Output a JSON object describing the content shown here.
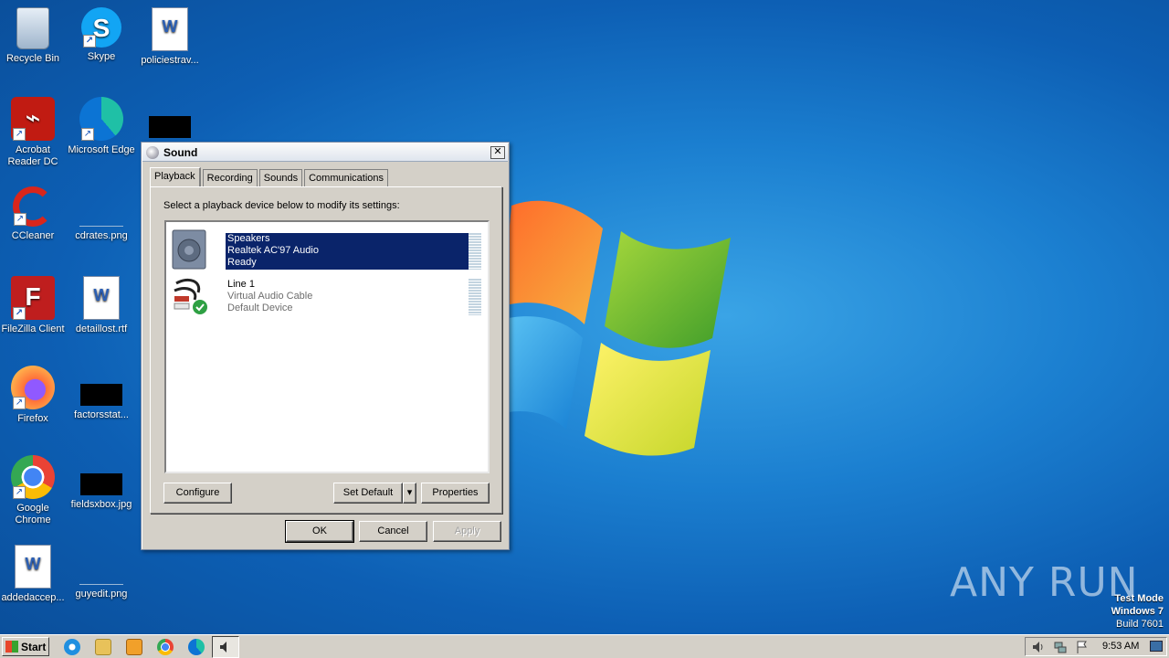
{
  "desktop": {
    "icons": [
      {
        "label": "Recycle Bin"
      },
      {
        "label": "Skype"
      },
      {
        "label": "policiestrav..."
      },
      {
        "label": "Acrobat Reader DC"
      },
      {
        "label": "Microsoft Edge"
      },
      {
        "label": "CCleaner"
      },
      {
        "label": "cdrates.png"
      },
      {
        "label": "FileZilla Client"
      },
      {
        "label": "detaillost.rtf"
      },
      {
        "label": "Firefox"
      },
      {
        "label": "factorsstat..."
      },
      {
        "label": "Google Chrome"
      },
      {
        "label": "fieldsxbox.jpg"
      },
      {
        "label": "addedaccep..."
      },
      {
        "label": "guyedit.png"
      }
    ],
    "watermark": {
      "line1": "Test Mode",
      "line2": "Windows 7",
      "line3": "Build 7601"
    },
    "brand": "ANY RUN"
  },
  "dialog": {
    "title": "Sound",
    "close_label": "✕",
    "tabs": [
      {
        "label": "Playback"
      },
      {
        "label": "Recording"
      },
      {
        "label": "Sounds"
      },
      {
        "label": "Communications"
      }
    ],
    "instruction": "Select a playback device below to modify its settings:",
    "devices": [
      {
        "name": "Speakers",
        "driver": "Realtek AC'97 Audio",
        "status": "Ready",
        "selected": true
      },
      {
        "name": "Line 1",
        "driver": "Virtual Audio Cable",
        "status": "Default Device",
        "selected": false
      }
    ],
    "buttons": {
      "configure": "Configure",
      "set_default": "Set Default",
      "dropdown": "▾",
      "properties": "Properties",
      "ok": "OK",
      "cancel": "Cancel",
      "apply": "Apply"
    }
  },
  "taskbar": {
    "start_label": "Start",
    "clock": "9:53 AM"
  }
}
